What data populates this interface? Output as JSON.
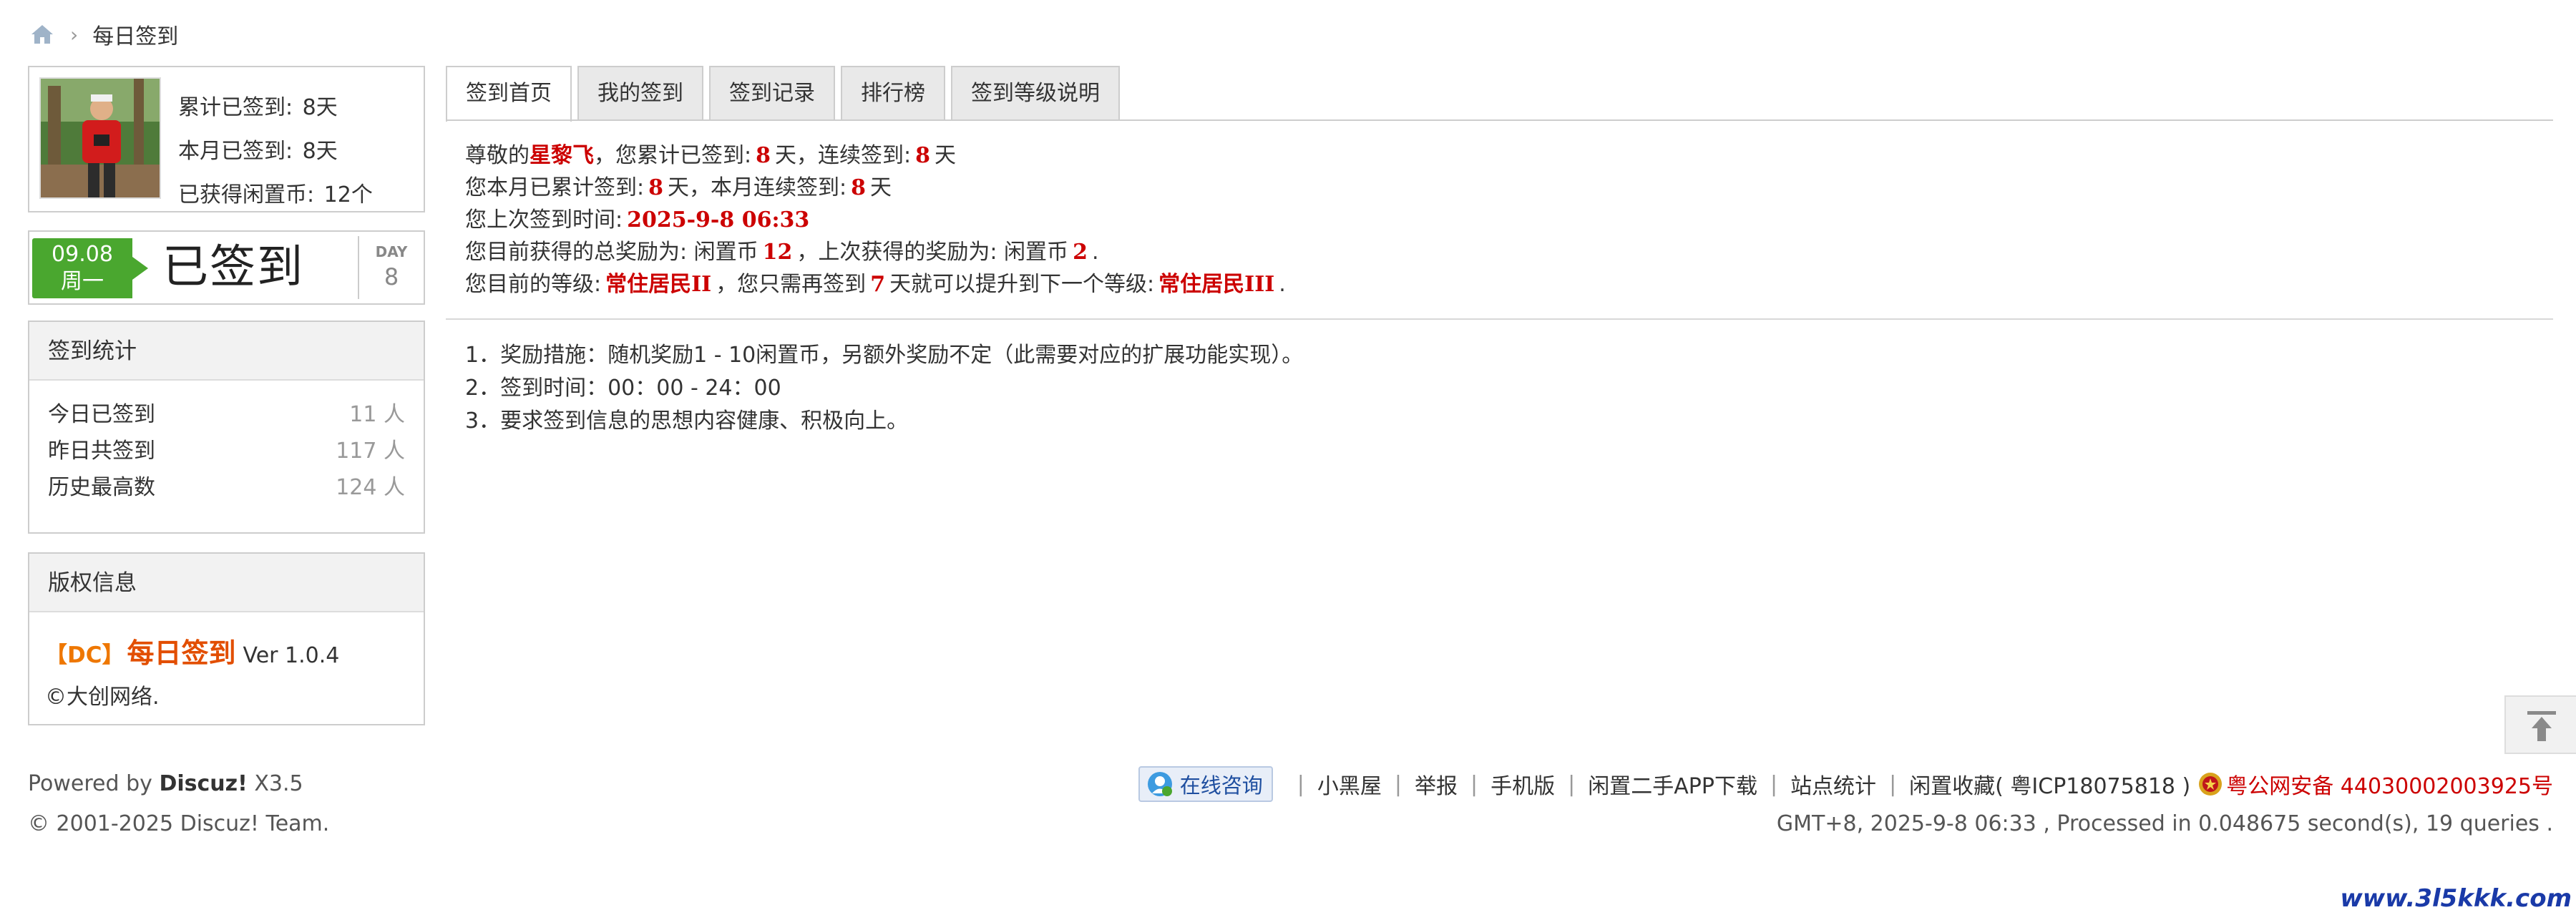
{
  "breadcrumb": {
    "separator": "›",
    "current": "每日签到"
  },
  "user": {
    "total_label": "累计已签到:",
    "total_value": "8天",
    "month_label": "本月已签到:",
    "month_value": "8天",
    "coins_label": "已获得闲置币:",
    "coins_value": "12个"
  },
  "sign_status": {
    "date": "09.08",
    "weekday": "周一",
    "status": "已签到",
    "day_label": "DAY",
    "day_value": "8"
  },
  "stats": {
    "title": "签到统计",
    "rows": [
      {
        "label": "今日已签到",
        "value": "11 人"
      },
      {
        "label": "昨日共签到",
        "value": "117 人"
      },
      {
        "label": "历史最高数",
        "value": "124 人"
      }
    ]
  },
  "copyright": {
    "title": "版权信息",
    "tag": "【DC】",
    "name": "每日签到",
    "version": "Ver 1.0.4",
    "owner": "©大创网络."
  },
  "tabs": [
    "签到首页",
    "我的签到",
    "签到记录",
    "排行榜",
    "签到等级说明"
  ],
  "info": {
    "line1": {
      "a": "尊敬的",
      "name": "星黎飞",
      "b": "，您累计已签到:",
      "total": "8",
      "c": "天，连续签到:",
      "streak": "8",
      "d": "天"
    },
    "line2": {
      "a": "您本月已累计签到:",
      "month": "8",
      "b": "天，本月连续签到:",
      "month_streak": "8",
      "c": "天"
    },
    "line3": {
      "a": "您上次签到时间:",
      "time": "2025-9-8 06:33"
    },
    "line4": {
      "a": "您目前获得的总奖励为: 闲置币",
      "total": "12",
      "b": "，上次获得的奖励为: 闲置币",
      "last": "2",
      "c": "."
    },
    "line5": {
      "a": "您目前的等级:",
      "level": "常住居民II",
      "b": "，您只需再签到",
      "need": "7",
      "c": "天就可以提升到下一个等级:",
      "next": "常住居民III",
      "d": "."
    }
  },
  "rules": [
    "1．奖励措施：随机奖励1 - 10闲置币，另额外奖励不定（此需要对应的扩展功能实现）。",
    "2．签到时间：00：00 - 24：00",
    "3．要求签到信息的思想内容健康、积极向上。"
  ],
  "footer": {
    "powered_prefix": "Powered by",
    "powered_brand": "Discuz!",
    "powered_ver": "X3.5",
    "copyright": "© 2001-2025 Discuz! Team.",
    "online_label": "在线咨询",
    "links": [
      "小黑屋",
      "举报",
      "手机版",
      "闲置二手APP下载",
      "站点统计"
    ],
    "site_name": "闲置收藏",
    "icp": "( 粤ICP18075818 )",
    "police": "粤公网安备 44030002003925号",
    "gmt": "GMT+8, 2025-9-8 06:33 , Processed in 0.048675 second(s), 19 queries .",
    "watermark": "www.3l5kkk.com"
  },
  "colors": {
    "accent_red": "#cc0000",
    "sign_green": "#4aa72f",
    "brand_orange": "#e24e00"
  }
}
